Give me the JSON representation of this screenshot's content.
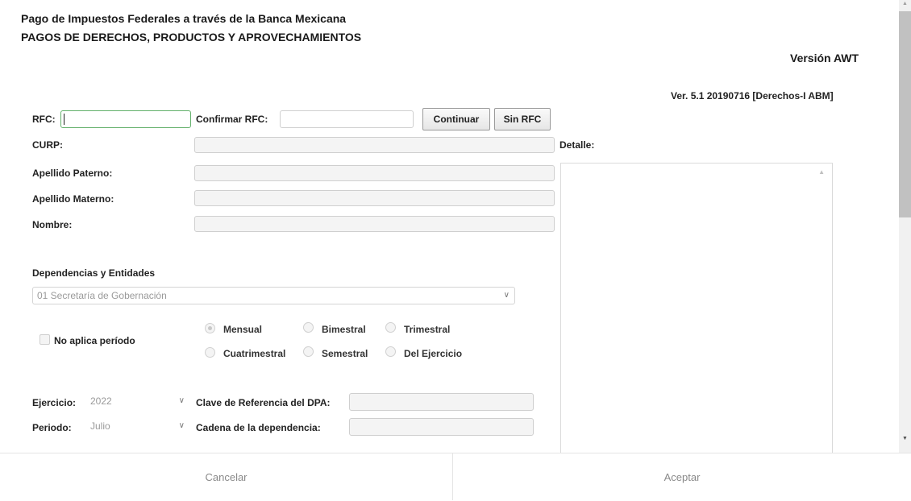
{
  "header": {
    "title": "Pago de Impuestos Federales a través de la Banca Mexicana",
    "subtitle": "PAGOS DE DERECHOS, PRODUCTOS Y APROVECHAMIENTOS",
    "version_label": "Versión AWT",
    "version_detail": "Ver. 5.1 20190716 [Derechos-I ABM]"
  },
  "form": {
    "rfc_label": "RFC:",
    "rfc_value": "",
    "confirm_rfc_label": "Confirmar RFC:",
    "continue_button": "Continuar",
    "no_rfc_button": "Sin RFC",
    "curp_label": "CURP:",
    "detalle_label": "Detalle:",
    "apellido_paterno_label": "Apellido Paterno:",
    "apellido_materno_label": "Apellido Materno:",
    "nombre_label": "Nombre:",
    "dependencias_label": "Dependencias y Entidades",
    "dependencia_selected": "01 Secretaría de Gobernación",
    "no_aplica_label": "No aplica período",
    "periodicity": {
      "selected": "Mensual",
      "options": [
        "Mensual",
        "Bimestral",
        "Trimestral",
        "Cuatrimestral",
        "Semestral",
        "Del Ejercicio"
      ]
    },
    "ejercicio_label": "Ejercicio:",
    "ejercicio_value": "2022",
    "clave_label": "Clave de Referencia del DPA:",
    "periodo_label": "Periodo:",
    "periodo_value": "Julio",
    "cadena_label": "Cadena de la dependencia:"
  },
  "footer": {
    "cancel_label": "Cancelar",
    "accept_label": "Aceptar"
  },
  "icons": {
    "chevron": "chevron-down-icon",
    "scroll_up": "scroll-up-icon",
    "scroll_down": "scroll-down-icon"
  }
}
